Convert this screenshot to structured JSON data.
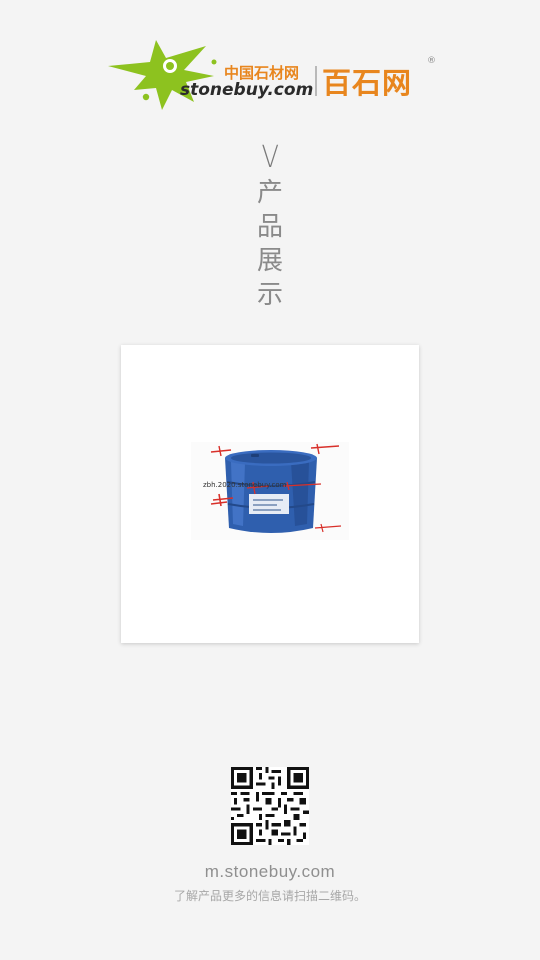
{
  "header": {
    "logo": {
      "cn_name": "中国石材网",
      "domain": "stonebuy.com",
      "brand": "百石网",
      "registered_mark": "®",
      "brand_color": "#e8861e",
      "mark_color": "#8dc21f"
    }
  },
  "section": {
    "chevron": "V",
    "title_chars": [
      "产",
      "品",
      "展",
      "示"
    ]
  },
  "product": {
    "image_icon": "blue-drum-image",
    "watermark_text": "zbh.2020.stonebuy.com"
  },
  "footer": {
    "qr_icon": "qr-code-icon",
    "url": "m.stonebuy.com",
    "note": "了解产品更多的信息请扫描二维码。"
  }
}
